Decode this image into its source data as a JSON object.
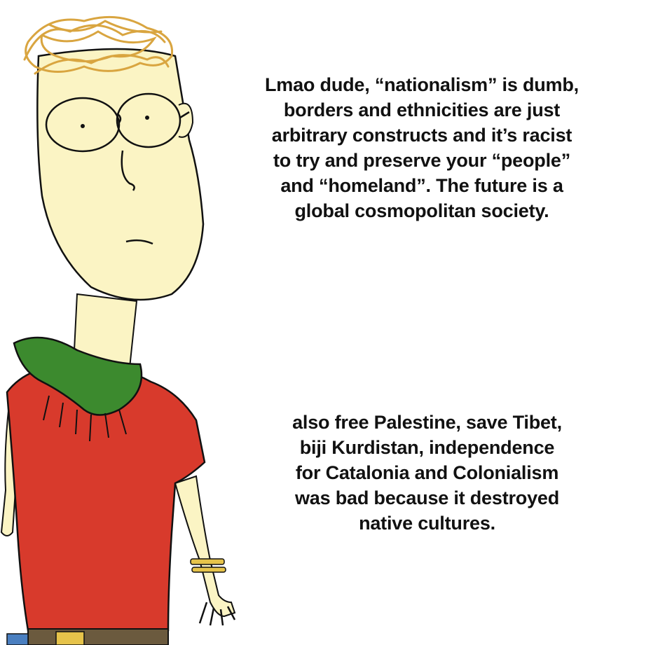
{
  "caption_top": "Lmao dude, “nationalism” is dumb,\nborders and ethnicities are just\narbitrary constructs and it’s racist\nto try and preserve your “people”\nand “homeland”. The future is a\nglobal cosmopolitan society.",
  "caption_bottom": "also free Palestine, save Tibet,\nbiji Kurdistan, independence\nfor Catalonia and Colonialism\nwas bad because it destroyed\nnative cultures.",
  "colors": {
    "skin": "#fbf4c4",
    "hair": "#d9a540",
    "shirt": "#d83a2c",
    "scarf": "#3c8a2e",
    "bracelet": "#e6c34a",
    "belt": "#4a7fc0",
    "outline": "#111111"
  },
  "icons": [
    "cartoon-man-drawing"
  ]
}
